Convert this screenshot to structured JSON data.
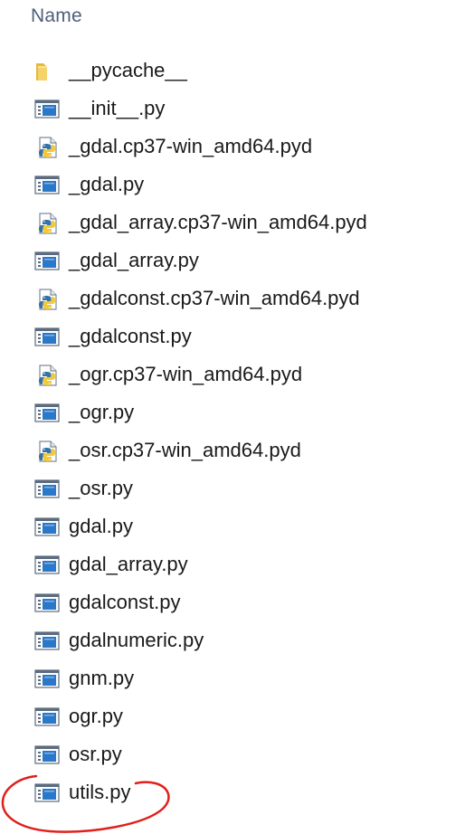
{
  "header": {
    "name_column": "Name"
  },
  "files": [
    {
      "name": "__pycache__",
      "icon": "folder-icon"
    },
    {
      "name": "__init__.py",
      "icon": "python-script-icon"
    },
    {
      "name": "_gdal.cp37-win_amd64.pyd",
      "icon": "python-extension-icon"
    },
    {
      "name": "_gdal.py",
      "icon": "python-script-icon"
    },
    {
      "name": "_gdal_array.cp37-win_amd64.pyd",
      "icon": "python-extension-icon"
    },
    {
      "name": "_gdal_array.py",
      "icon": "python-script-icon"
    },
    {
      "name": "_gdalconst.cp37-win_amd64.pyd",
      "icon": "python-extension-icon"
    },
    {
      "name": "_gdalconst.py",
      "icon": "python-script-icon"
    },
    {
      "name": "_ogr.cp37-win_amd64.pyd",
      "icon": "python-extension-icon"
    },
    {
      "name": "_ogr.py",
      "icon": "python-script-icon"
    },
    {
      "name": "_osr.cp37-win_amd64.pyd",
      "icon": "python-extension-icon"
    },
    {
      "name": "_osr.py",
      "icon": "python-script-icon"
    },
    {
      "name": "gdal.py",
      "icon": "python-script-icon"
    },
    {
      "name": "gdal_array.py",
      "icon": "python-script-icon"
    },
    {
      "name": "gdalconst.py",
      "icon": "python-script-icon"
    },
    {
      "name": "gdalnumeric.py",
      "icon": "python-script-icon"
    },
    {
      "name": "gnm.py",
      "icon": "python-script-icon"
    },
    {
      "name": "ogr.py",
      "icon": "python-script-icon"
    },
    {
      "name": "osr.py",
      "icon": "python-script-icon"
    },
    {
      "name": "utils.py",
      "icon": "python-script-icon"
    }
  ],
  "colors": {
    "header_text": "#4c607a",
    "file_text": "#1a1a1a",
    "folder": "#f0c84a",
    "script_blue": "#2b78c8",
    "annotation": "#e0201b"
  },
  "annotation": {
    "circled_file": "utils.py"
  }
}
